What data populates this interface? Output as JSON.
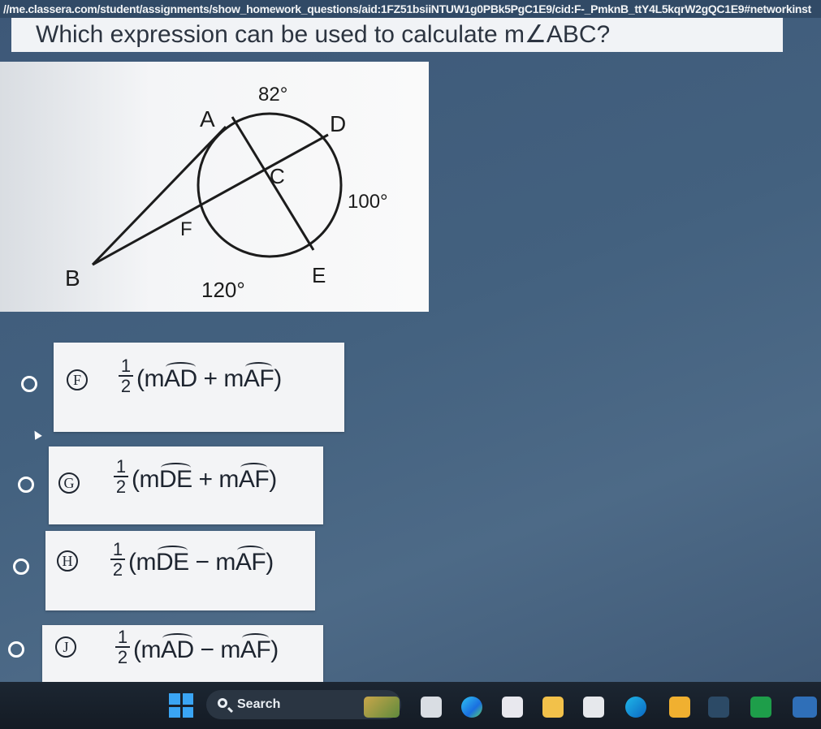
{
  "browser": {
    "url": "//me.classera.com/student/assignments/show_homework_questions/aid:1FZ51bsiiNTUW1g0PBk5PgC1E9/cid:F-_PmknB_ttY4L5kqrW2gQC1E9#networkinst"
  },
  "question": {
    "text": "Which expression can be used to calculate m∠ABC?"
  },
  "figure": {
    "points": {
      "A": "A",
      "B": "B",
      "C": "C",
      "D": "D",
      "E": "E",
      "F": "F"
    },
    "arcs": {
      "top": "82°",
      "right": "100°",
      "bottom": "120°"
    }
  },
  "options": [
    {
      "letter": "F",
      "num": "1",
      "den": "2",
      "open": "(m",
      "arc1": "AD",
      "op": " + m",
      "arc2": "AF",
      "close": ")"
    },
    {
      "letter": "G",
      "num": "1",
      "den": "2",
      "open": "(m",
      "arc1": "DE",
      "op": " + m",
      "arc2": "AF",
      "close": ")"
    },
    {
      "letter": "H",
      "num": "1",
      "den": "2",
      "open": "(m",
      "arc1": "DE",
      "op": " − m",
      "arc2": "AF",
      "close": ")"
    },
    {
      "letter": "J",
      "num": "1",
      "den": "2",
      "open": "(m",
      "arc1": "AD",
      "op": " − m",
      "arc2": "AF",
      "close": ")"
    }
  ],
  "taskbar": {
    "search_label": "Search"
  },
  "colors": {
    "background": "#43617f",
    "card": "#f3f4f6",
    "radio": "#ffffff",
    "windows_accent": "#3aa5f4"
  }
}
